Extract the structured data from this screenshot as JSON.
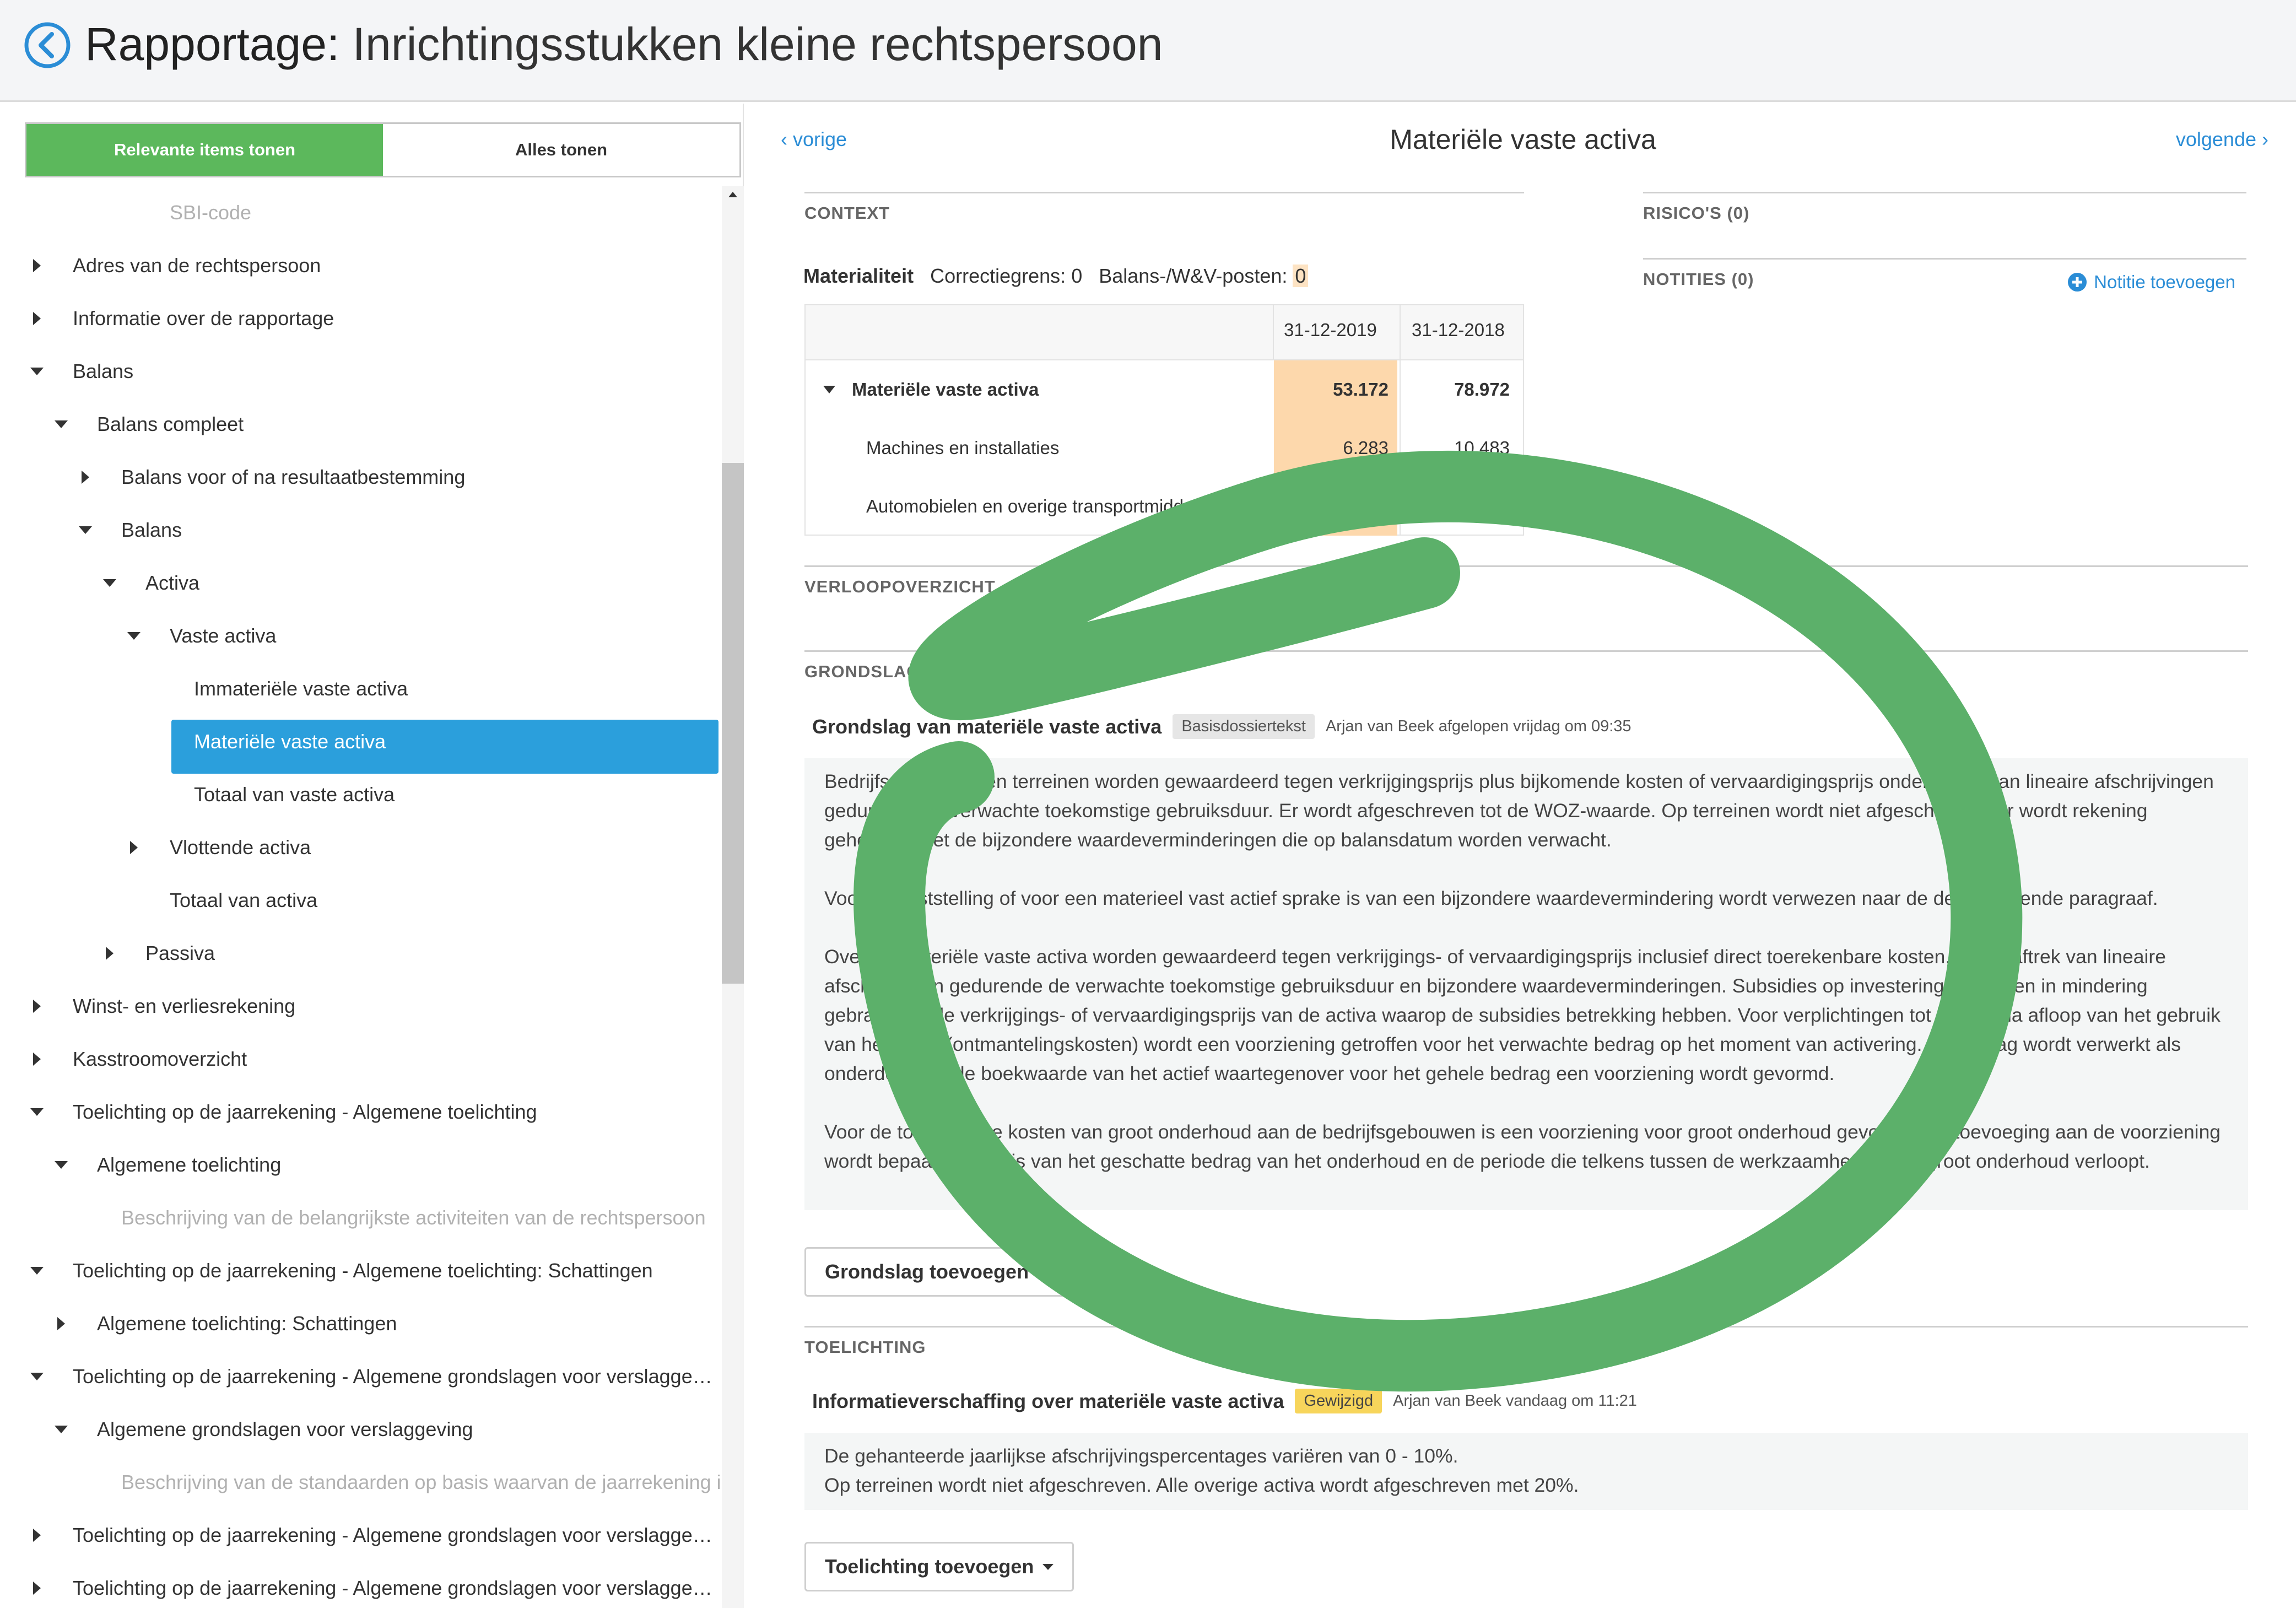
{
  "header": {
    "title_prefix": "Rapportage:",
    "title_main": "Inrichtingsstukken kleine rechtspersoon"
  },
  "sidebar": {
    "toggle": {
      "relevant_label": "Relevante items tonen",
      "all_label": "Alles tonen",
      "active": "relevant"
    },
    "items": [
      {
        "label": "SBI-code",
        "level": 4,
        "arrow": "none",
        "muted": true
      },
      {
        "label": "Adres van de rechtspersoon",
        "level": 0,
        "arrow": "right"
      },
      {
        "label": "Informatie over de rapportage",
        "level": 0,
        "arrow": "right"
      },
      {
        "label": "Balans",
        "level": 0,
        "arrow": "down"
      },
      {
        "label": "Balans compleet",
        "level": 1,
        "arrow": "down"
      },
      {
        "label": "Balans voor of na resultaatbestemming",
        "level": 2,
        "arrow": "right"
      },
      {
        "label": "Balans",
        "level": 2,
        "arrow": "down"
      },
      {
        "label": "Activa",
        "level": 3,
        "arrow": "down"
      },
      {
        "label": "Vaste activa",
        "level": 4,
        "arrow": "down"
      },
      {
        "label": "Immateriële vaste activa",
        "level": 5,
        "arrow": "none"
      },
      {
        "label": "Materiële vaste activa",
        "level": 5,
        "arrow": "none",
        "selected": true
      },
      {
        "label": "Totaal van vaste activa",
        "level": 5,
        "arrow": "none"
      },
      {
        "label": "Vlottende activa",
        "level": 4,
        "arrow": "right"
      },
      {
        "label": "Totaal van activa",
        "level": 4,
        "arrow": "none"
      },
      {
        "label": "Passiva",
        "level": 3,
        "arrow": "right"
      },
      {
        "label": "Winst- en verliesrekening",
        "level": 0,
        "arrow": "right"
      },
      {
        "label": "Kasstroomoverzicht",
        "level": 0,
        "arrow": "right"
      },
      {
        "label": "Toelichting op de jaarrekening - Algemene toelichting",
        "level": 0,
        "arrow": "down"
      },
      {
        "label": "Algemene toelichting",
        "level": 1,
        "arrow": "down"
      },
      {
        "label": "Beschrijving van de belangrijkste activiteiten van de rechtspersoon",
        "level": 2,
        "arrow": "none",
        "muted": true
      },
      {
        "label": "Toelichting op de jaarrekening - Algemene toelichting: Schattingen",
        "level": 0,
        "arrow": "down"
      },
      {
        "label": "Algemene toelichting: Schattingen",
        "level": 1,
        "arrow": "right"
      },
      {
        "label": "Toelichting op de jaarrekening - Algemene grondslagen voor verslagge…",
        "level": 0,
        "arrow": "down"
      },
      {
        "label": "Algemene grondslagen voor verslaggeving",
        "level": 1,
        "arrow": "down"
      },
      {
        "label": "Beschrijving van de standaarden op basis waarvan de jaarrekening i",
        "level": 2,
        "arrow": "none",
        "muted": true
      },
      {
        "label": "Toelichting op de jaarrekening - Algemene grondslagen voor verslagge…",
        "level": 0,
        "arrow": "right"
      },
      {
        "label": "Toelichting op de jaarrekening - Algemene grondslagen voor verslagge…",
        "level": 0,
        "arrow": "right"
      }
    ]
  },
  "nav": {
    "prev_label": "vorige",
    "next_label": "volgende",
    "title": "Materiële vaste activa"
  },
  "context": {
    "heading": "CONTEXT",
    "materiality": {
      "label": "Materialiteit",
      "correction_label": "Correctiegrens:",
      "correction_value": "0",
      "posts_label": "Balans-/W&V-posten:",
      "posts_value": "0"
    },
    "table": {
      "col1": "31-12-2019",
      "col2": "31-12-2018",
      "rows": [
        {
          "name": "Materiële vaste activa",
          "v1": "53.172",
          "v2": "78.972",
          "bold": true,
          "expanded": true
        },
        {
          "name": "Machines en installaties",
          "v1": "6.283",
          "v2": "10.483"
        },
        {
          "name": "Automobielen en overige transportmiddelen",
          "v1": "",
          "v2": ""
        }
      ]
    }
  },
  "right_panel": {
    "risks_heading": "RISICO'S (0)",
    "notes_heading": "NOTITIES (0)",
    "add_note_label": "Notitie toevoegen"
  },
  "verloop": {
    "heading": "VERLOOPOVERZICHT"
  },
  "grondslag": {
    "heading": "GRONDSLAG",
    "entry_title": "Grondslag van materiële vaste activa",
    "badge": "Basisdossiertekst",
    "meta": "Arjan van Beek afgelopen vrijdag om 09:35",
    "paragraphs": [
      "Bedrijfsgebouwen en terreinen worden gewaardeerd tegen verkrijgingsprijs plus bijkomende kosten of vervaardigingsprijs onder aftrek van lineaire afschrijvingen gedurende de verwachte toekomstige gebruiksduur. Er wordt afgeschreven tot de WOZ-waarde. Op terreinen wordt niet afgeschreven. Er wordt rekening gehouden met de bijzondere waardeverminderingen die op balansdatum worden verwacht.",
      "Voor de vaststelling of voor een materieel vast actief sprake is van een bijzondere waardevermindering wordt verwezen naar de desbetreffende paragraaf.",
      "Overige materiële vaste activa worden gewaardeerd tegen verkrijgings- of vervaardigingsprijs inclusief direct toerekenbare kosten, onder aftrek van lineaire afschrijvingen gedurende de verwachte toekomstige gebruiksduur en bijzondere waardeverminderingen. Subsidies op investeringen worden in mindering gebracht op de verkrijgings- of vervaardigingsprijs van de activa waarop de subsidies betrekking hebben. Voor verplichtingen tot herstel na afloop van het gebruik van het actief (ontmantelingskosten) wordt een voorziening getroffen voor het verwachte bedrag op het moment van activering. Dit bedrag wordt verwerkt als onderdeel van de boekwaarde van het actief waartegenover voor het gehele bedrag een voorziening wordt gevormd.",
      "Voor de toekomstige kosten van groot onderhoud aan de bedrijfsgebouwen is een voorziening voor groot onderhoud gevormd. De toevoeging aan de voorziening wordt bepaald op basis van het geschatte bedrag van het onderhoud en de periode die telkens tussen de werkzaamheden van groot onderhoud verloopt."
    ],
    "add_button": "Grondslag toevoegen"
  },
  "toelichting": {
    "heading": "TOELICHTING",
    "entry_title": "Informatieverschaffing over materiële vaste activa",
    "badge": "Gewijzigd",
    "meta": "Arjan van Beek vandaag om 11:21",
    "lines": [
      "De gehanteerde jaarlijkse afschrijvingspercentages variëren van 0 - 10%.",
      "Op terreinen wordt niet afgeschreven. Alle overige activa wordt afgeschreven met 20%."
    ],
    "add_button": "Toelichting toevoegen"
  },
  "colors": {
    "accent_green": "#5cb85c",
    "selection_blue": "#2b9fdc",
    "link_blue": "#2b8dd6",
    "highlight_orange": "#fdd8ac",
    "badge_yellow": "#f7d55b",
    "annotation_green": "#5cb06a"
  }
}
